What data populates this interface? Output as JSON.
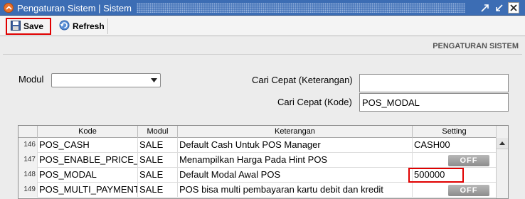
{
  "window": {
    "title": "Pengaturan Sistem | Sistem"
  },
  "toolbar": {
    "save_label": "Save",
    "refresh_label": "Refresh"
  },
  "section_title": "PENGATURAN SISTEM",
  "filters": {
    "modul_label": "Modul",
    "modul_value": "",
    "cari_keterangan_label": "Cari Cepat (Keterangan)",
    "cari_keterangan_value": "",
    "cari_kode_label": "Cari Cepat (Kode)",
    "cari_kode_value": "POS_MODAL"
  },
  "grid": {
    "columns": [
      "Kode",
      "Modul",
      "Keterangan",
      "Setting"
    ],
    "rows": [
      {
        "num": "146",
        "kode": "POS_CASH",
        "modul": "SALE",
        "keterangan": "Default Cash Untuk POS Manager",
        "setting": "CASH00"
      },
      {
        "num": "147",
        "kode": "POS_ENABLE_PRICE_",
        "modul": "SALE",
        "keterangan": "Menampilkan Harga Pada Hint POS",
        "setting": "OFF"
      },
      {
        "num": "148",
        "kode": "POS_MODAL",
        "modul": "SALE",
        "keterangan": "Default Modal Awal POS",
        "setting": "500000"
      },
      {
        "num": "149",
        "kode": "POS_MULTI_PAYMENT",
        "modul": "SALE",
        "keterangan": "POS bisa multi pembayaran kartu debit dan kredit",
        "setting": "OFF"
      }
    ]
  },
  "colors": {
    "titlebar": "#3c6db4",
    "highlight": "#e00000"
  }
}
